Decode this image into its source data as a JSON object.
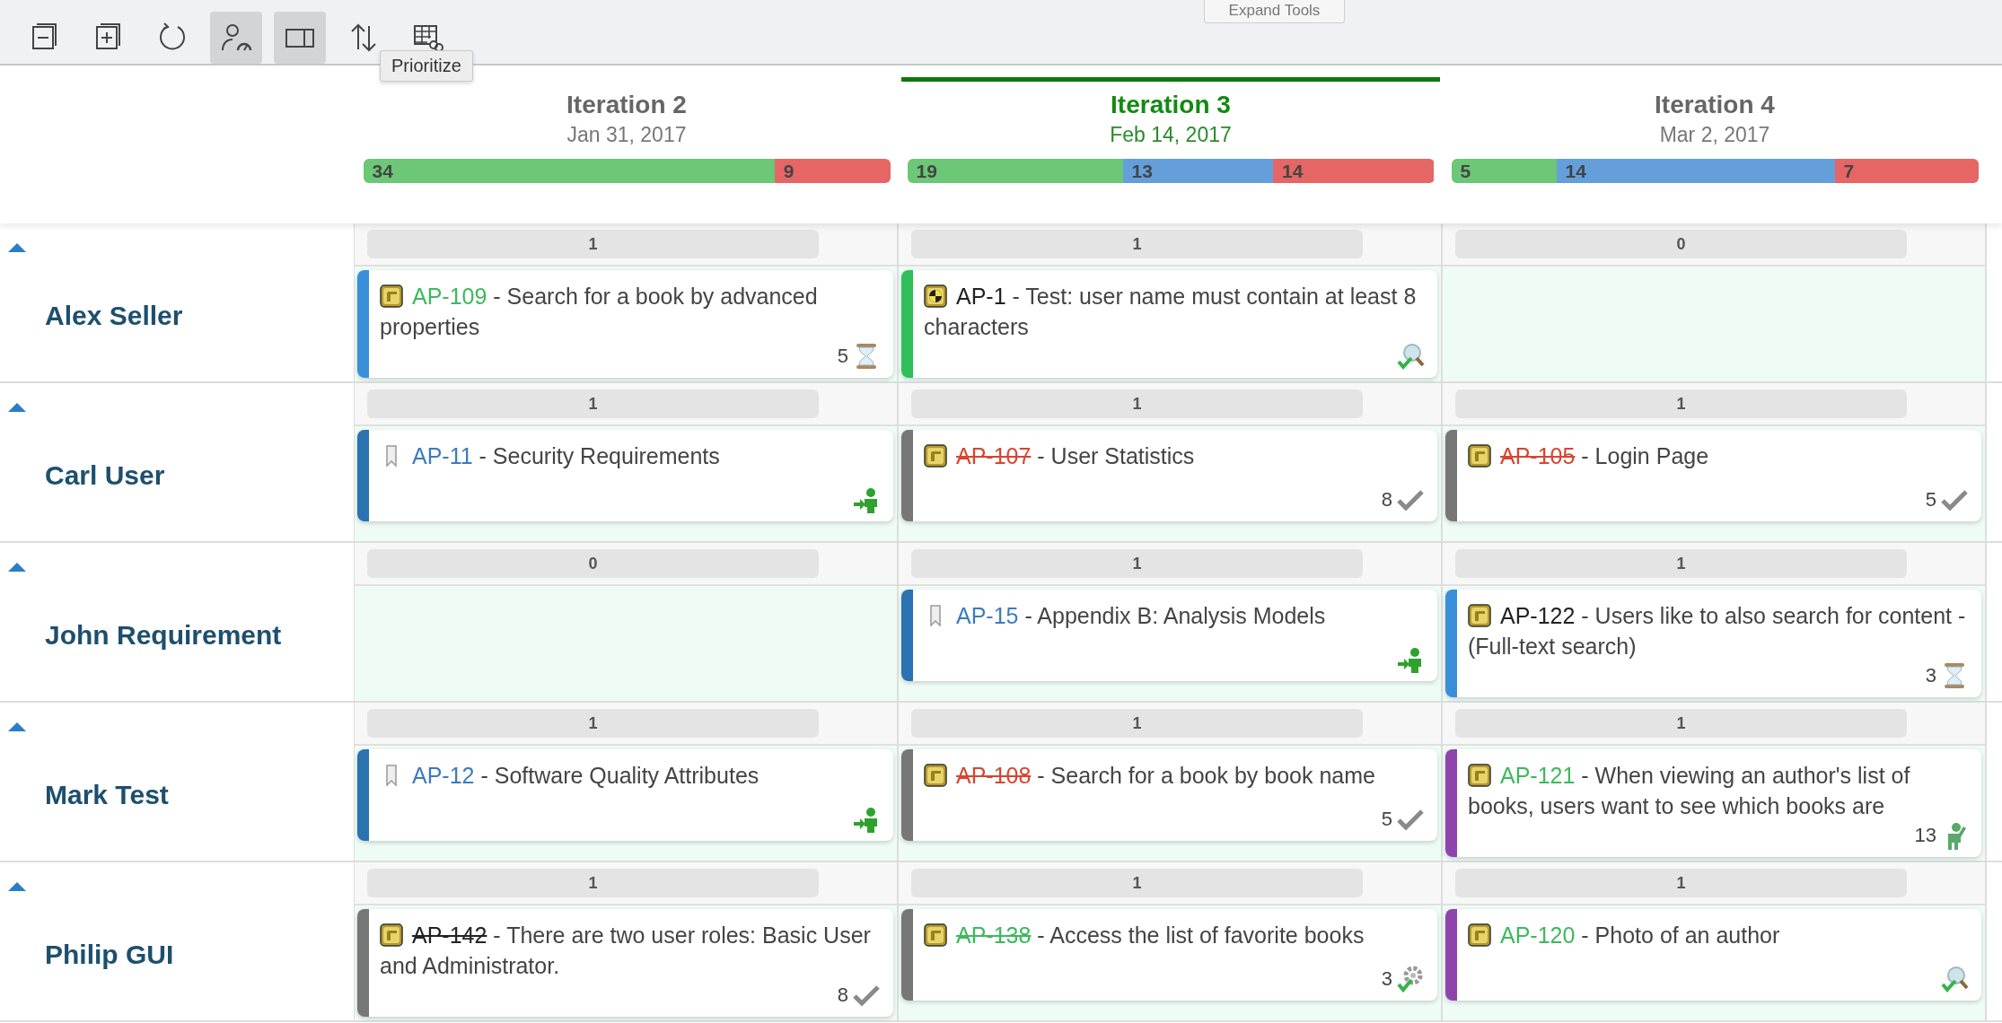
{
  "toolbar": {
    "tools": [
      {
        "kind": "collapse",
        "selected": false
      },
      {
        "kind": "expand",
        "selected": false
      },
      {
        "kind": "refresh",
        "selected": false
      },
      {
        "kind": "person-gauge",
        "selected": true
      },
      {
        "kind": "split",
        "selected": true
      },
      {
        "kind": "sort",
        "selected": false
      },
      {
        "kind": "table-link",
        "selected": false,
        "tooltip": "Prioritize"
      }
    ],
    "expand_tab": "Expand Tools"
  },
  "iterations": [
    {
      "name": "Iteration 2",
      "date": "Jan 31, 2017",
      "selected": false,
      "segments": [
        {
          "value": "34",
          "color": "#6cc776"
        },
        {
          "value": "9",
          "color": "#e66565"
        }
      ]
    },
    {
      "name": "Iteration 3",
      "date": "Feb 14, 2017",
      "selected": true,
      "segments": [
        {
          "value": "19",
          "color": "#6cc776"
        },
        {
          "value": "13",
          "color": "#649fdc"
        },
        {
          "value": "14",
          "color": "#e66565"
        }
      ]
    },
    {
      "name": "Iteration 4",
      "date": "Mar 2, 2017",
      "selected": false,
      "segments": [
        {
          "value": "5",
          "color": "#6cc776"
        },
        {
          "value": "14",
          "color": "#649fdc"
        },
        {
          "value": "7",
          "color": "#e66565"
        }
      ]
    }
  ],
  "lanes": [
    {
      "name": "Alex Seller",
      "expanded": true,
      "cells": [
        {
          "count": "1",
          "cards": [
            {
              "icon": {
                "kind": "requirement"
              },
              "link": {
                "text": "AP-109",
                "color": "#3cb95c",
                "struck": false
              },
              "title": "- Search for a book by advanced properties",
              "points": "5",
              "status_icon": {
                "kind": "hourglass"
              },
              "color": "#3a8fd9"
            }
          ]
        },
        {
          "count": "1",
          "cards": [
            {
              "icon": {
                "kind": "test"
              },
              "link": {
                "text": "AP-1",
                "color": "#222222",
                "struck": false
              },
              "title": "- Test: user name must contain at least 8 characters",
              "status_icon": {
                "kind": "review"
              },
              "color": "#2fbf5b"
            }
          ]
        },
        {
          "count": "0"
        }
      ]
    },
    {
      "name": "Carl User",
      "expanded": true,
      "cells": [
        {
          "count": "1",
          "cards": [
            {
              "icon": {
                "kind": "section"
              },
              "link": {
                "text": "AP-11",
                "color": "#3a7bbf",
                "struck": false
              },
              "title": "- Security Requirements",
              "status_icon": {
                "kind": "assign"
              },
              "color": "#2a72b0"
            }
          ]
        },
        {
          "count": "1",
          "cards": [
            {
              "icon": {
                "kind": "requirement"
              },
              "link": {
                "text": "AP-107",
                "color": "#d9442f",
                "struck": true
              },
              "title": "- User Statistics",
              "points": "8",
              "status_icon": {
                "kind": "done"
              },
              "color": "#777777"
            }
          ]
        },
        {
          "count": "1",
          "cards": [
            {
              "icon": {
                "kind": "requirement"
              },
              "link": {
                "text": "AP-105",
                "color": "#d9442f",
                "struck": true
              },
              "title": "- Login Page",
              "points": "5",
              "status_icon": {
                "kind": "done"
              },
              "color": "#777777"
            }
          ]
        }
      ]
    },
    {
      "name": "John Requirement",
      "expanded": true,
      "cells": [
        {
          "count": "0"
        },
        {
          "count": "1",
          "cards": [
            {
              "icon": {
                "kind": "section"
              },
              "link": {
                "text": "AP-15",
                "color": "#3a7bbf",
                "struck": false
              },
              "title": "- Appendix B: Analysis Models",
              "status_icon": {
                "kind": "assign"
              },
              "color": "#2a72b0"
            }
          ]
        },
        {
          "count": "1",
          "cards": [
            {
              "icon": {
                "kind": "requirement"
              },
              "link": {
                "text": "AP-122",
                "color": "#222222",
                "struck": false
              },
              "title": "- Users like to also search for content - (Full-text search)",
              "points": "3",
              "status_icon": {
                "kind": "hourglass"
              },
              "color": "#3a8fd9"
            }
          ]
        }
      ]
    },
    {
      "name": "Mark Test",
      "expanded": true,
      "cells": [
        {
          "count": "1",
          "cards": [
            {
              "icon": {
                "kind": "section"
              },
              "link": {
                "text": "AP-12",
                "color": "#3a7bbf",
                "struck": false
              },
              "title": "- Software Quality Attributes",
              "status_icon": {
                "kind": "assign"
              },
              "color": "#2a72b0"
            }
          ]
        },
        {
          "count": "1",
          "cards": [
            {
              "icon": {
                "kind": "requirement"
              },
              "link": {
                "text": "AP-108",
                "color": "#d9442f",
                "struck": true
              },
              "title": "- Search for a book by book name",
              "points": "5",
              "status_icon": {
                "kind": "done"
              },
              "color": "#777777"
            }
          ]
        },
        {
          "count": "1",
          "cards": [
            {
              "icon": {
                "kind": "requirement"
              },
              "link": {
                "text": "AP-121",
                "color": "#3cb95c",
                "struck": false
              },
              "title": "- When viewing an author's list of books, users want to see which books are",
              "points": "13",
              "status_icon": {
                "kind": "person"
              },
              "color": "#8e44ad"
            }
          ]
        }
      ]
    },
    {
      "name": "Philip GUI",
      "expanded": true,
      "cells": [
        {
          "count": "1",
          "cards": [
            {
              "icon": {
                "kind": "requirement"
              },
              "link": {
                "text": "AP-142",
                "color": "#222222",
                "struck": true
              },
              "title": "- There are two user roles: Basic User and Administrator.",
              "points": "8",
              "status_icon": {
                "kind": "done"
              },
              "color": "#777777"
            }
          ]
        },
        {
          "count": "1",
          "cards": [
            {
              "icon": {
                "kind": "requirement"
              },
              "link": {
                "text": "AP-138",
                "color": "#3cb95c",
                "struck": true
              },
              "title": "- Access the list of favorite books",
              "points": "3",
              "status_icon": {
                "kind": "verify"
              },
              "color": "#777777"
            }
          ]
        },
        {
          "count": "1",
          "cards": [
            {
              "icon": {
                "kind": "requirement"
              },
              "link": {
                "text": "AP-120",
                "color": "#3cb95c",
                "struck": false
              },
              "title": "- Photo of an author",
              "status_icon": {
                "kind": "review"
              },
              "color": "#8e44ad"
            }
          ]
        }
      ]
    }
  ]
}
